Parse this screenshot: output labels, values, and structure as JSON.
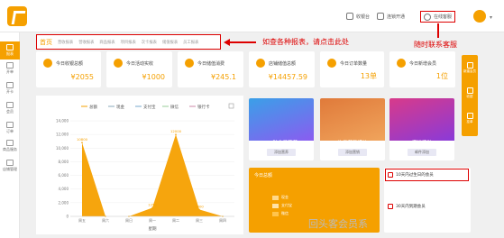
{
  "colors": {
    "accent": "#f5a000",
    "annotation": "#dd0000"
  },
  "header": {
    "buttons": [
      {
        "label": "收银台",
        "icon": "cashier-icon"
      },
      {
        "label": "连锁开通",
        "icon": "chain-icon"
      },
      {
        "label": "在线客服",
        "icon": "chat-icon"
      }
    ]
  },
  "sidebar": {
    "items": [
      {
        "label": "报表",
        "icon": "chart-icon"
      },
      {
        "label": "开单",
        "icon": "bill-icon"
      },
      {
        "label": "开卡",
        "icon": "card-icon"
      },
      {
        "label": "会员",
        "icon": "member-icon"
      },
      {
        "label": "订单",
        "icon": "order-icon"
      },
      {
        "label": "商品服务",
        "icon": "goods-icon"
      },
      {
        "label": "店铺管理",
        "icon": "store-icon"
      }
    ]
  },
  "tabs": [
    "首页",
    "营收报表",
    "营收报表",
    "商品报表",
    "项目报表",
    "次卡报表",
    "储值报表",
    "员工报表"
  ],
  "annotations": {
    "tabs_note": "如查各种报表，请点击此处",
    "service_note": "随时联系客服"
  },
  "stats": [
    {
      "label": "今日收银总额",
      "value": "¥2055"
    },
    {
      "label": "今日活动实收",
      "value": "¥1000"
    },
    {
      "label": "今日储值消费",
      "value": "¥245.1"
    },
    {
      "label": "店铺储值总额",
      "value": "¥14457.59"
    },
    {
      "label": "今日订单数量",
      "value": "13单"
    },
    {
      "label": "今日新增会员",
      "value": "1位"
    }
  ],
  "quick": [
    {
      "label": "新建会员",
      "icon": "add-member-icon"
    },
    {
      "label": "收银",
      "icon": "cash-icon"
    },
    {
      "label": "挂单",
      "icon": "hold-icon"
    }
  ],
  "chart_data": {
    "type": "area",
    "legend": [
      "总额",
      "现金",
      "支付宝",
      "微信",
      "银行卡"
    ],
    "legend_position": "top",
    "categories": [
      "周五",
      "周六",
      "周日",
      "周一",
      "周二",
      "周三",
      "周四"
    ],
    "series": [
      {
        "name": "总额",
        "values": [
          10800,
          0,
          0,
          1250,
          12000,
          1000,
          0
        ]
      }
    ],
    "point_labels": [
      "10800",
      "",
      "",
      "1250",
      "12000",
      "1000",
      ""
    ],
    "y_ticks": [
      "0",
      "2,000",
      "4,000",
      "6,000",
      "8,000",
      "10,000",
      "12,000",
      "14,000"
    ],
    "ylim": [
      0,
      14000
    ],
    "xlabel": "星期"
  },
  "promos": [
    {
      "text": "1.6种会员营养",
      "button": "添加营养"
    },
    {
      "text": "生日营销模块",
      "button": "添加营销"
    },
    {
      "text": "满送活动",
      "button": "邮件添加"
    }
  ],
  "today": {
    "title": "今日总额",
    "legend": [
      {
        "label": "现金",
        "color": "#ffd88a"
      },
      {
        "label": "支付宝",
        "color": "#ffe2a6"
      },
      {
        "label": "微信",
        "color": "#ffc44d"
      }
    ]
  },
  "reminders": [
    "10天内过生日的会员",
    "30天内到期会员"
  ],
  "watermark": "回头客会员系"
}
